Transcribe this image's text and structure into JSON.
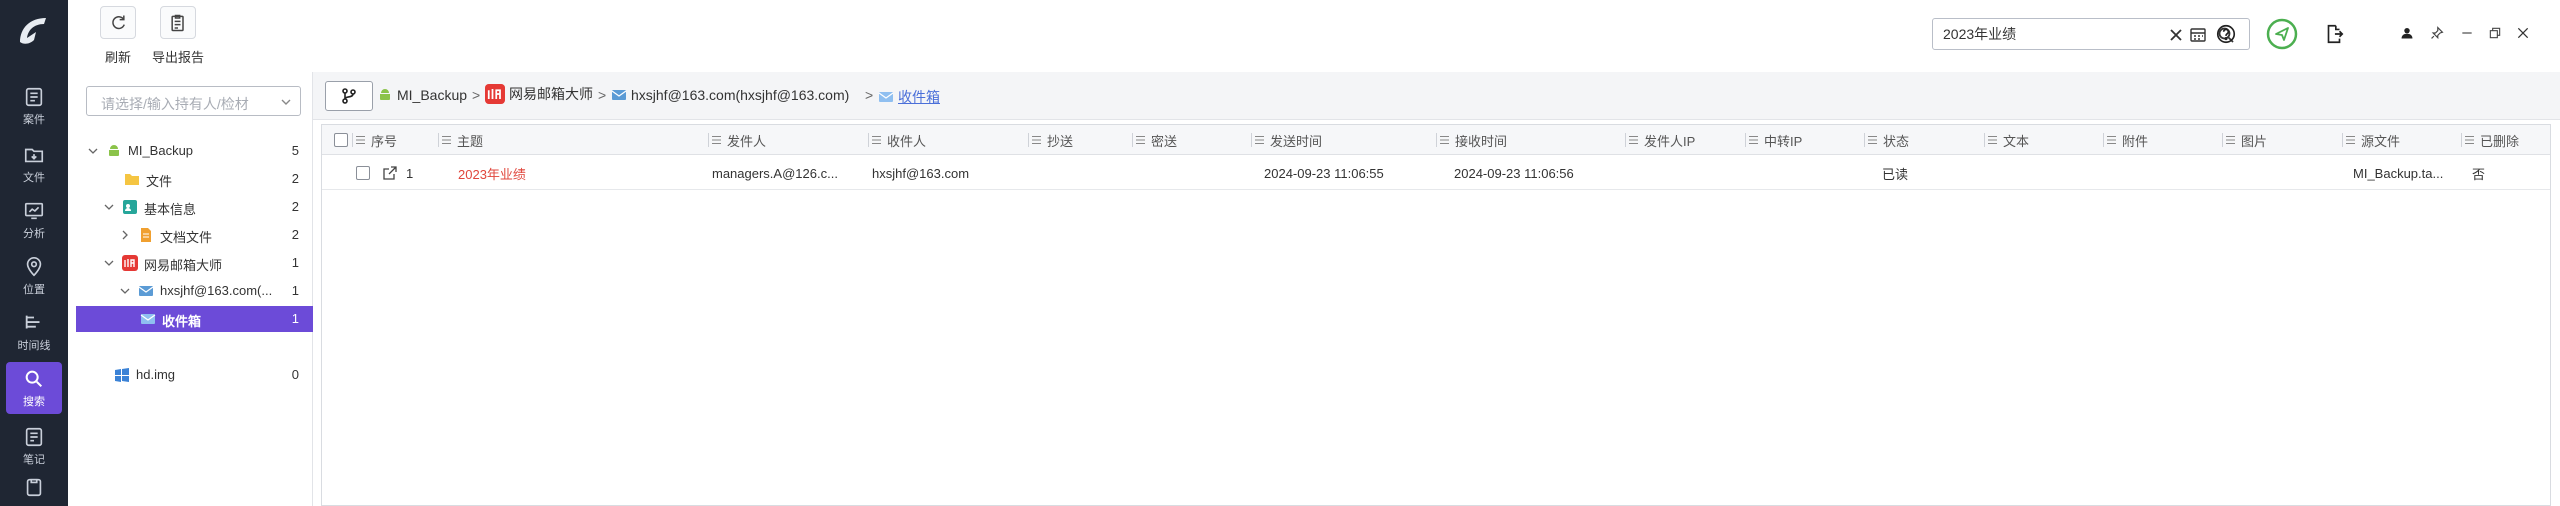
{
  "toolbar": {
    "refresh_label": "刷新",
    "export_label": "导出报告"
  },
  "search": {
    "value": "2023年业绩"
  },
  "rail": {
    "items": [
      {
        "label": "案件",
        "icon": "case-icon"
      },
      {
        "label": "文件",
        "icon": "folder-icon"
      },
      {
        "label": "分析",
        "icon": "analysis-icon"
      },
      {
        "label": "位置",
        "icon": "location-pin-icon"
      },
      {
        "label": "时间线",
        "icon": "timeline-icon"
      },
      {
        "label": "搜索",
        "icon": "search-icon",
        "active": true
      },
      {
        "label": "笔记",
        "icon": "notes-icon"
      }
    ]
  },
  "tree": {
    "placeholder": "请选择/输入持有人/检材",
    "nodes": [
      {
        "label": "MI_Backup",
        "count": "5"
      },
      {
        "label": "文件",
        "count": "2"
      },
      {
        "label": "基本信息",
        "count": "2"
      },
      {
        "label": "文档文件",
        "count": "2"
      },
      {
        "label": "网易邮箱大师",
        "count": "1"
      },
      {
        "label": "hxsjhf@163.com(...",
        "count": "1"
      },
      {
        "label": "收件箱",
        "count": "1"
      },
      {
        "label": "hd.img",
        "count": "0"
      }
    ]
  },
  "breadcrumb": {
    "items": [
      "MI_Backup",
      "网易邮箱大师",
      "hxsjhf@163.com(hxsjhf@163.com)",
      "收件箱"
    ],
    "separator": ">"
  },
  "table": {
    "columns": [
      "序号",
      "主题",
      "发件人",
      "收件人",
      "抄送",
      "密送",
      "发送时间",
      "接收时间",
      "发件人IP",
      "中转IP",
      "状态",
      "文本",
      "附件",
      "图片",
      "源文件",
      "已删除"
    ],
    "rows": [
      {
        "index": "1",
        "subject": "2023年业绩",
        "sender": "managers.A@126.c...",
        "recipient": "hxsjhf@163.com",
        "cc": "",
        "bcc": "",
        "sent_time": "2024-09-23 11:06:55",
        "received_time": "2024-09-23 11:06:56",
        "sender_ip": "",
        "relay_ip": "",
        "status": "已读",
        "text": "",
        "attachment": "",
        "image": "",
        "source_file": "MI_Backup.ta...",
        "deleted": "否"
      }
    ]
  },
  "colors": {
    "rail_bg": "#1f2633",
    "accent": "#6c4bd8",
    "subject_red": "#e0463c",
    "link_blue": "#4a6fd9",
    "send_green": "#4caf50"
  }
}
